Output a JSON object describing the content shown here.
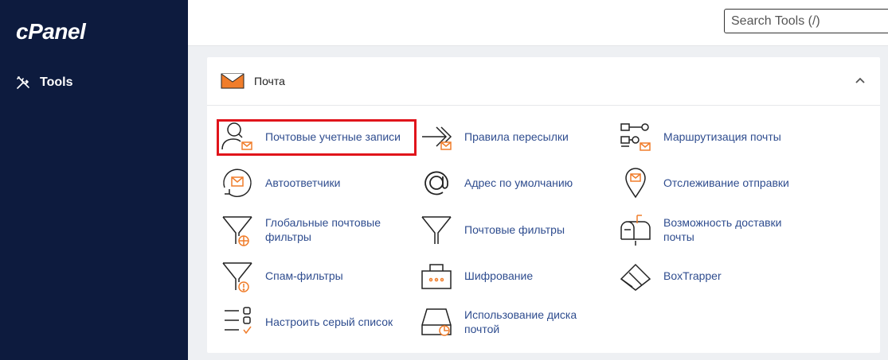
{
  "sidebar": {
    "logo": "cPanel",
    "tools_label": "Tools"
  },
  "search": {
    "placeholder": "Search Tools (/)"
  },
  "section": {
    "title": "Почта",
    "items": [
      {
        "label": "Почтовые учетные записи",
        "icon": "email-accounts-icon"
      },
      {
        "label": "Правила пересылки",
        "icon": "forwarders-icon"
      },
      {
        "label": "Маршрутизация почты",
        "icon": "email-routing-icon"
      },
      {
        "label": "Автоответчики",
        "icon": "autoresponders-icon"
      },
      {
        "label": "Адрес по умолчанию",
        "icon": "default-address-icon"
      },
      {
        "label": "Отслеживание отправки",
        "icon": "track-delivery-icon"
      },
      {
        "label": "Глобальные почтовые фильтры",
        "icon": "global-filters-icon"
      },
      {
        "label": "Почтовые фильтры",
        "icon": "email-filters-icon"
      },
      {
        "label": "Возможность доставки почты",
        "icon": "email-deliverability-icon"
      },
      {
        "label": "Спам-фильтры",
        "icon": "spam-filters-icon"
      },
      {
        "label": "Шифрование",
        "icon": "encryption-icon"
      },
      {
        "label": "BoxTrapper",
        "icon": "boxtrapper-icon"
      },
      {
        "label": "Настроить серый список",
        "icon": "greylisting-icon"
      },
      {
        "label": "Использование диска почтой",
        "icon": "disk-usage-icon"
      }
    ]
  },
  "colors": {
    "sidebar": "#0d1b3e",
    "link": "#2f4d8f",
    "accent": "#f07d2b",
    "highlight": "#e0141b"
  }
}
